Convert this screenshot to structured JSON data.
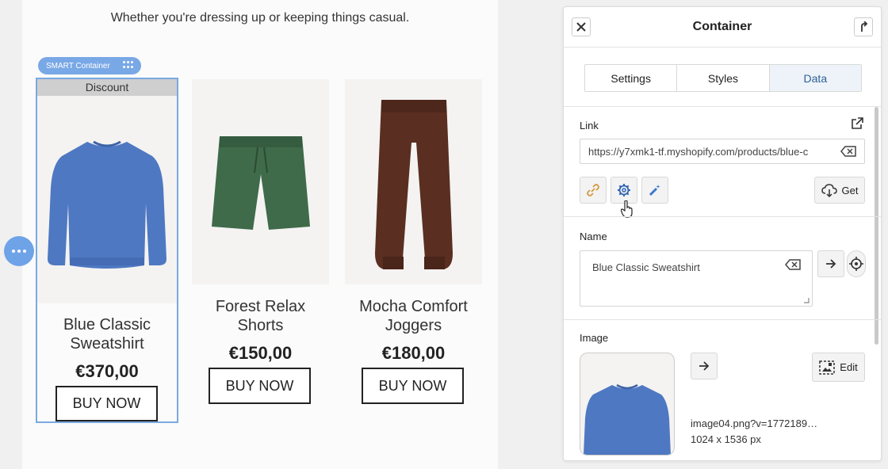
{
  "canvas": {
    "tagline": "Whether you're dressing up or keeping things casual.",
    "smart_badge": "SMART Container",
    "products": [
      {
        "discount": "Discount",
        "title": "Blue Classic Sweatshirt",
        "price": "€370,00",
        "button": "BUY NOW",
        "image_icon": "blue-sweatshirt-icon",
        "color": "#4f78c2"
      },
      {
        "title": "Forest Relax Shorts",
        "price": "€150,00",
        "button": "BUY NOW",
        "image_icon": "green-shorts-icon",
        "color": "#3f6b4a"
      },
      {
        "title": "Mocha Comfort Joggers",
        "price": "€180,00",
        "button": "BUY NOW",
        "image_icon": "brown-joggers-icon",
        "color": "#5a2e20"
      }
    ]
  },
  "panel": {
    "title": "Container",
    "tabs": [
      {
        "label": "Settings",
        "active": false
      },
      {
        "label": "Styles",
        "active": false
      },
      {
        "label": "Data",
        "active": true
      }
    ],
    "link": {
      "label": "Link",
      "value": "https://y7xmk1-tf.myshopify.com/products/blue-c",
      "get_label": "Get"
    },
    "name": {
      "label": "Name",
      "value": "Blue Classic Sweatshirt"
    },
    "image": {
      "label": "Image",
      "edit_label": "Edit",
      "filename": "image04.png?v=1772189…",
      "dimensions": "1024 x 1536 px"
    }
  },
  "colors": {
    "accent": "#6fa3e8",
    "active_tab_bg": "#eef3f9",
    "active_tab_text": "#2f5f99"
  }
}
